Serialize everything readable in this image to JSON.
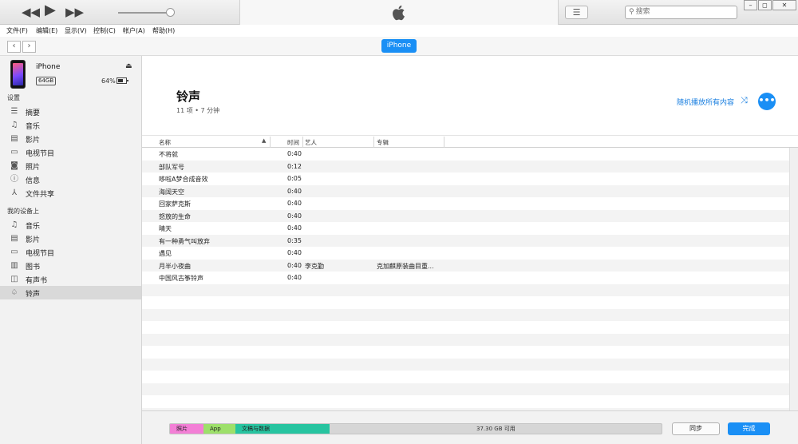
{
  "titlebar": {
    "search_placeholder": "搜索",
    "icons": [
      "rewind-icon",
      "play-icon",
      "fast-forward-icon",
      "apple-icon",
      "list-view-icon",
      "search-icon",
      "minimize-icon",
      "restore-icon",
      "close-icon"
    ]
  },
  "menubar": [
    "文件(F)",
    "编辑(E)",
    "显示(V)",
    "控制(C)",
    "帐户(A)",
    "帮助(H)"
  ],
  "nav": {
    "device_tab": "iPhone"
  },
  "device": {
    "name": "iPhone",
    "capacity": "64GB",
    "battery": "64%",
    "battery_level": 0.64
  },
  "sidebar": {
    "settings_title": "设置",
    "settings_items": [
      {
        "label": "摘要",
        "icon": "summary-icon"
      },
      {
        "label": "音乐",
        "icon": "music-icon"
      },
      {
        "label": "影片",
        "icon": "film-icon"
      },
      {
        "label": "电视节目",
        "icon": "tv-icon"
      },
      {
        "label": "照片",
        "icon": "camera-icon"
      },
      {
        "label": "信息",
        "icon": "info-icon"
      },
      {
        "label": "文件共享",
        "icon": "apps-icon"
      }
    ],
    "mydevice_title": "我的设备上",
    "mydevice_items": [
      {
        "label": "音乐",
        "icon": "music-icon"
      },
      {
        "label": "影片",
        "icon": "film-icon"
      },
      {
        "label": "电视节目",
        "icon": "tv-icon"
      },
      {
        "label": "图书",
        "icon": "book-icon"
      },
      {
        "label": "有声书",
        "icon": "audiobook-icon"
      },
      {
        "label": "铃声",
        "icon": "bell-icon",
        "active": true
      }
    ]
  },
  "main": {
    "title": "铃声",
    "subtitle": "11 项 • 7 分钟",
    "shuffle_label": "随机播放所有内容",
    "more_label": "•••"
  },
  "table": {
    "headers": {
      "name": "名称",
      "time": "时间",
      "artist": "艺人",
      "album": "专辑"
    },
    "rows": [
      {
        "name": "不将就",
        "time": "0:40",
        "artist": "",
        "album": ""
      },
      {
        "name": "部队军号",
        "time": "0:12",
        "artist": "",
        "album": ""
      },
      {
        "name": "哆啦A梦合成音效",
        "time": "0:05",
        "artist": "",
        "album": ""
      },
      {
        "name": "海阔天空",
        "time": "0:40",
        "artist": "",
        "album": ""
      },
      {
        "name": "回家萨克斯",
        "time": "0:40",
        "artist": "",
        "album": ""
      },
      {
        "name": "怒放的生命",
        "time": "0:40",
        "artist": "",
        "album": ""
      },
      {
        "name": "晴天",
        "time": "0:40",
        "artist": "",
        "album": ""
      },
      {
        "name": "有一种勇气叫放弃",
        "time": "0:35",
        "artist": "",
        "album": ""
      },
      {
        "name": "遇见",
        "time": "0:40",
        "artist": "",
        "album": ""
      },
      {
        "name": "月半小夜曲",
        "time": "0:40",
        "artist": "李克勤",
        "album": "克加麒原装曲目重..."
      },
      {
        "name": "中国风古筝铃声",
        "time": "0:40",
        "artist": "",
        "album": ""
      }
    ],
    "empty_rows": 11
  },
  "footer": {
    "segments": [
      {
        "label": "照片",
        "color": "#f37fd6"
      },
      {
        "label": "App",
        "color": "#9de06a"
      },
      {
        "label": "文稿与数据",
        "color": "#27c4a0"
      }
    ],
    "free_label": "37.30 GB 可用",
    "sync_label": "同步",
    "done_label": "完成"
  },
  "colors": {
    "accent": "#1a8ff5",
    "link": "#1a7fe0"
  }
}
